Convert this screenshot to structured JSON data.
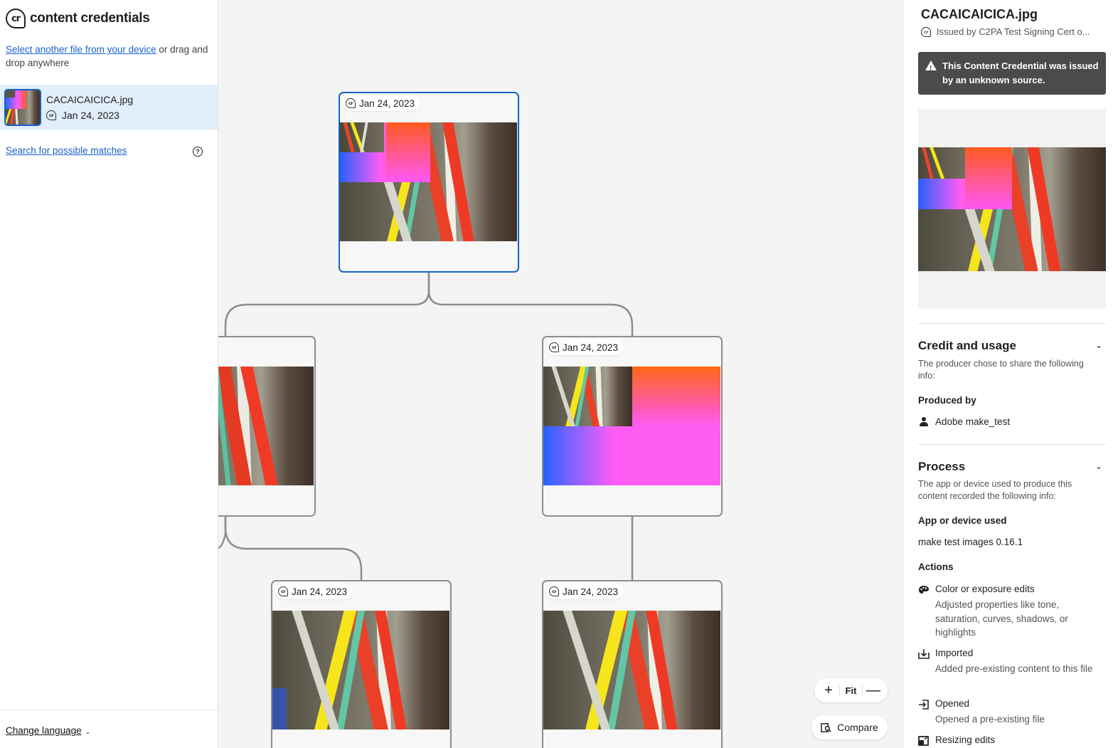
{
  "app": {
    "logo_icon": "cr",
    "title": "content credentials"
  },
  "sidebar": {
    "select_link": "Select another file from your device",
    "select_suffix": " or drag and drop anywhere",
    "file": {
      "name": "CACAICAICICA.jpg",
      "date": "Jan 24, 2023"
    },
    "search_link": "Search for possible matches",
    "help_icon": "?",
    "change_language": "Change language"
  },
  "canvas": {
    "nodes": [
      {
        "date": "Jan 24, 2023"
      },
      {
        "date": ""
      },
      {
        "date": "Jan 24, 2023"
      },
      {
        "date": "Jan 24, 2023"
      },
      {
        "date": "Jan 24, 2023"
      }
    ],
    "zoom_in": "+",
    "fit_label": "Fit",
    "zoom_out": "—",
    "compare_label": "Compare"
  },
  "panel": {
    "title": "CACAICAICICA.jpg",
    "issued": "Issued by C2PA Test Signing Cert o...",
    "warning": "This Content Credential was issued by an unknown source.",
    "credit": {
      "heading": "Credit and usage",
      "description": "The producer chose to share the following info:",
      "produced_by_label": "Produced by",
      "producer": "Adobe make_test"
    },
    "process": {
      "heading": "Process",
      "description": "The app or device used to produce this content recorded the following info:",
      "app_label": "App or device used",
      "app_value": "make test images 0.16.1",
      "actions_label": "Actions",
      "actions": [
        {
          "icon": "color-palette-icon",
          "title": "Color or exposure edits",
          "desc": "Adjusted properties like tone, saturation, curves, shadows, or highlights"
        },
        {
          "icon": "import-icon",
          "title": "Imported",
          "desc": "Added pre-existing content to this file"
        },
        {
          "icon": "open-icon",
          "title": "Opened",
          "desc": "Opened a pre-existing file"
        },
        {
          "icon": "resize-icon",
          "title": "Resizing edits",
          "desc": ""
        }
      ]
    }
  },
  "colors": {
    "accent": "#1660c8",
    "link": "#1a62c9",
    "selected_bg": "#e1eefb",
    "warning_bg": "#4b4b4b",
    "canvas_bg": "#f4f4f4"
  }
}
